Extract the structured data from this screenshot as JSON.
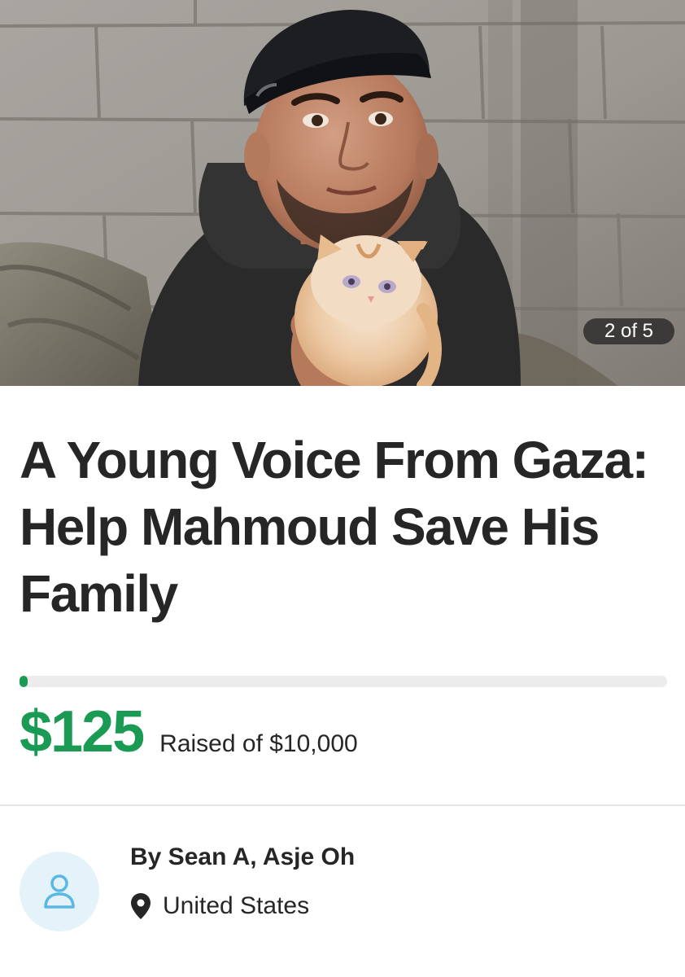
{
  "gallery": {
    "counter": "2 of 5"
  },
  "campaign": {
    "title": "A Young Voice From Gaza: Help Mahmoud Save His Family",
    "amount_raised": "$125",
    "raised_text": "Raised of $10,000",
    "progress_fraction": 0.0125
  },
  "organizer": {
    "byline": "By Sean A, Asje Oh",
    "location": "United States",
    "icons": [
      "user-icon",
      "location-pin-icon"
    ]
  },
  "colors": {
    "accent_green": "#1b9a54",
    "avatar_bg": "#e4f3fa",
    "avatar_icon": "#5bb8e3"
  }
}
